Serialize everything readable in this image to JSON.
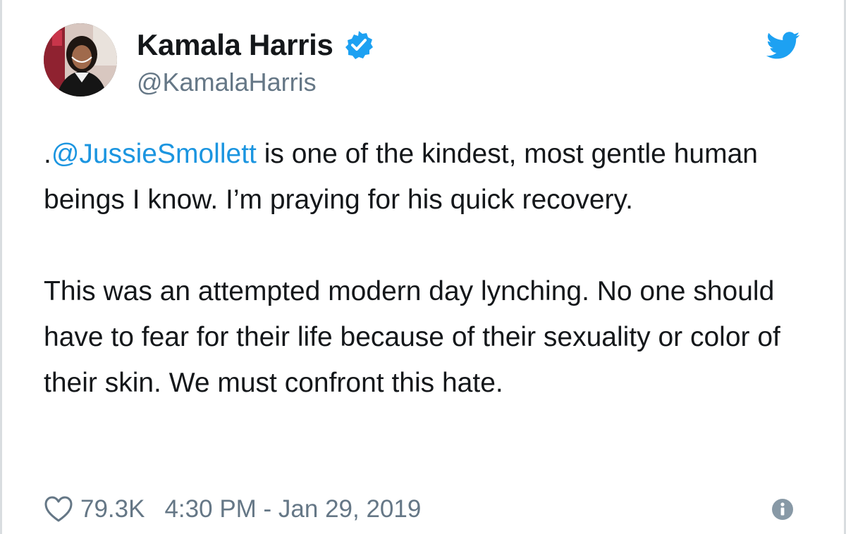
{
  "tweet": {
    "author": {
      "name": "Kamala Harris",
      "handle": "@KamalaHarris",
      "verified": true,
      "avatar_icon": "profile-photo"
    },
    "text": {
      "mention": "@JussieSmollett",
      "line1_prefix": ".",
      "line1_rest": " is one of the kindest, most gentle human beings I know. I’m praying for his quick recovery.",
      "para2": "This was an attempted modern day lynching. No one should have to fear for their life because of their sexuality or color of their skin. We must confront this hate."
    },
    "likes": "79.3K",
    "timestamp": "4:30 PM - Jan 29, 2019",
    "icons": {
      "brand": "twitter-bird-icon",
      "verified": "verified-badge-icon",
      "like": "heart-icon",
      "info": "info-icon"
    },
    "colors": {
      "brand_blue": "#1da1f2",
      "mention_blue": "#1b95e0",
      "text": "#14171a",
      "secondary": "#657786"
    }
  }
}
